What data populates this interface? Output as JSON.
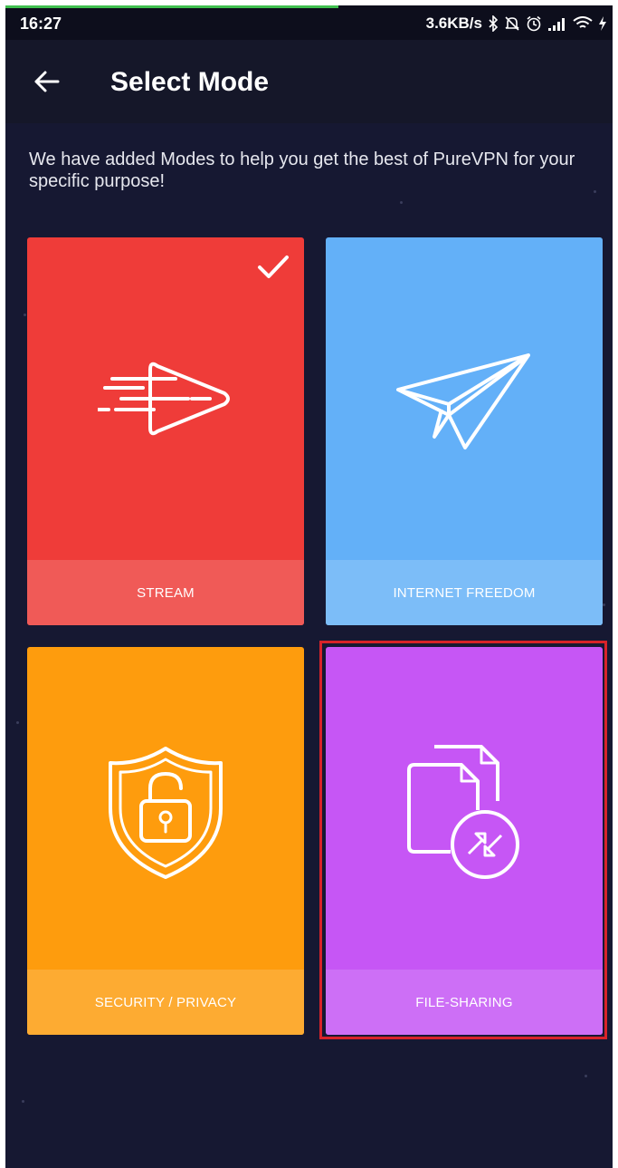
{
  "status_bar": {
    "time": "16:27",
    "net_speed": "3.6KB/s",
    "icons": [
      "bluetooth-icon",
      "muted-bell-icon",
      "alarm-icon",
      "signal-icon",
      "wifi-icon",
      "charging-icon"
    ]
  },
  "header": {
    "title": "Select Mode",
    "back_icon": "arrow-left-icon"
  },
  "description": "We have added Modes to help you get the best of PureVPN for your specific purpose!",
  "modes": [
    {
      "label": "STREAM",
      "color": "#ef3c39",
      "label_color": "#f05a57",
      "icon": "play-speed-icon",
      "selected": true
    },
    {
      "label": "INTERNET FREEDOM",
      "color": "#63b0f8",
      "label_color": "#7cbdf8",
      "icon": "paper-plane-icon",
      "selected": false
    },
    {
      "label": "SECURITY / PRIVACY",
      "color": "#fe9c0d",
      "label_color": "#fdab32",
      "icon": "shield-lock-icon",
      "selected": false
    },
    {
      "label": "FILE-SHARING",
      "color": "#c656f5",
      "label_color": "#cd6ff6",
      "icon": "file-transfer-icon",
      "selected": false
    }
  ],
  "highlight_color": "#d8232a"
}
